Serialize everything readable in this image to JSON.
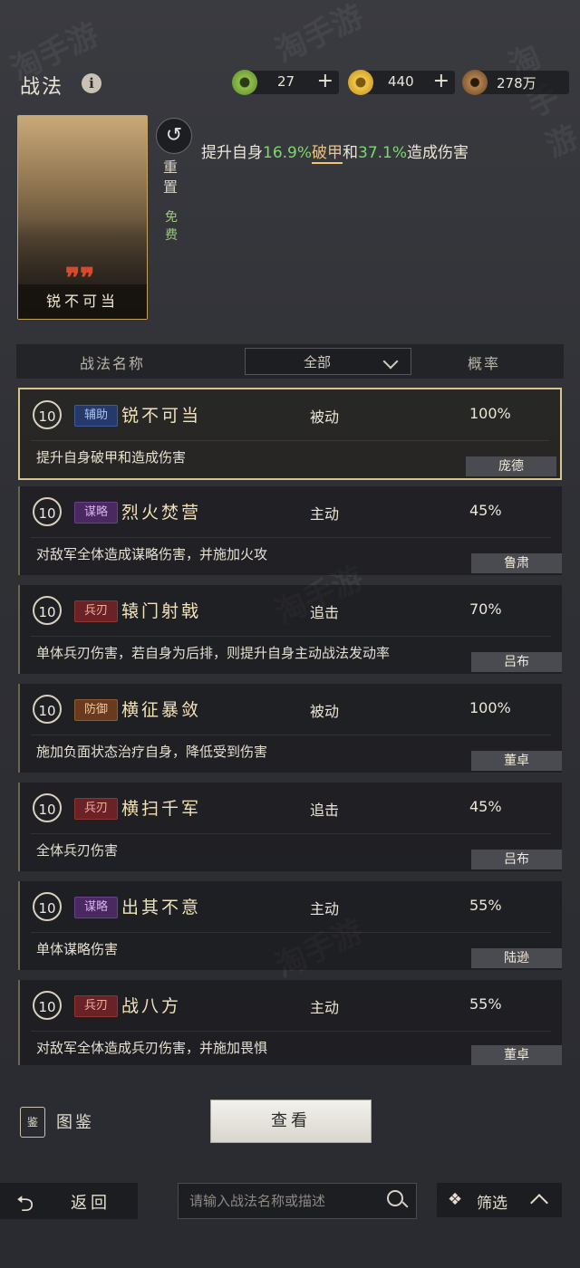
{
  "header": {
    "title": "战法",
    "info_icon": "i",
    "resources": [
      {
        "icon": "jade-coin-icon",
        "value": "27",
        "has_plus": true,
        "color": "#8fbf4a"
      },
      {
        "icon": "gold-coin-icon",
        "value": "440",
        "has_plus": true,
        "color": "#e0b63a"
      },
      {
        "icon": "copper-coin-icon",
        "value": "278万",
        "has_plus": false,
        "color": "#9a7040"
      }
    ]
  },
  "selected": {
    "card_name": "锐不可当",
    "reset_label": "重置",
    "free_label": "免费",
    "desc_prefix": "提升自身",
    "desc_pct1": "16.9%",
    "desc_key": "破甲",
    "desc_and": "和",
    "desc_pct2": "37.1%",
    "desc_suffix": "造成伤害"
  },
  "table": {
    "col_name": "战法名称",
    "filter_value": "全部",
    "col_rate": "概率"
  },
  "rows": [
    {
      "level": "10",
      "tag": "辅助",
      "name": "锐不可当",
      "type": "被动",
      "rate": "100%",
      "desc": "提升自身破甲和造成伤害",
      "hero": "庞德"
    },
    {
      "level": "10",
      "tag": "谋略",
      "name": "烈火焚营",
      "type": "主动",
      "rate": "45%",
      "desc": "对敌军全体造成谋略伤害，并施加火攻",
      "hero": "鲁肃"
    },
    {
      "level": "10",
      "tag": "兵刃",
      "name": "辕门射戟",
      "type": "追击",
      "rate": "70%",
      "desc": "单体兵刃伤害，若自身为后排，则提升自身主动战法发动率",
      "hero": "吕布"
    },
    {
      "level": "10",
      "tag": "防御",
      "name": "横征暴敛",
      "type": "被动",
      "rate": "100%",
      "desc": "施加负面状态治疗自身，降低受到伤害",
      "hero": "董卓"
    },
    {
      "level": "10",
      "tag": "兵刃",
      "name": "横扫千军",
      "type": "追击",
      "rate": "45%",
      "desc": "全体兵刃伤害",
      "hero": "吕布"
    },
    {
      "level": "10",
      "tag": "谋略",
      "name": "出其不意",
      "type": "主动",
      "rate": "55%",
      "desc": "单体谋略伤害",
      "hero": "陆逊"
    },
    {
      "level": "10",
      "tag": "兵刃",
      "name": "战八方",
      "type": "主动",
      "rate": "55%",
      "desc": "对敌军全体造成兵刃伤害，并施加畏惧",
      "hero": "董卓"
    }
  ],
  "bottom": {
    "catalog_icon": "鉴",
    "catalog_label": "图鉴",
    "view_label": "查看",
    "back_label": "返回",
    "search_placeholder": "请输入战法名称或描述",
    "filter_label": "筛选"
  },
  "watermark": "淘手游"
}
